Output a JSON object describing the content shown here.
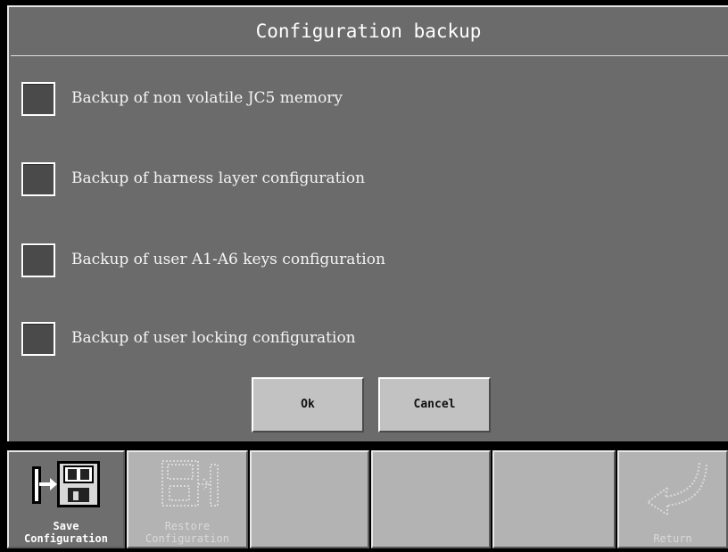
{
  "dialog": {
    "title": "Configuration backup",
    "options": [
      {
        "label": "Backup of non volatile JC5 memory",
        "checked": false
      },
      {
        "label": "Backup of harness layer configuration",
        "checked": false
      },
      {
        "label": "Backup of user A1-A6 keys configuration",
        "checked": false
      },
      {
        "label": "Backup of user locking configuration",
        "checked": false
      }
    ],
    "ok_label": "Ok",
    "cancel_label": "Cancel"
  },
  "toolbar": {
    "save": {
      "line1": "Save",
      "line2": "Configuration",
      "icon": "save-configuration-icon"
    },
    "restore": {
      "line1": "Restore",
      "line2": "Configuration",
      "icon": "restore-configuration-icon"
    },
    "return": {
      "label": "Return",
      "icon": "return-arrow-icon"
    }
  },
  "colors": {
    "dialog_bg": "#6b6b6b",
    "button_bg": "#c2c2c2",
    "toolbar_active": "#6e6e6e",
    "toolbar_bg": "#b3b3b3"
  }
}
